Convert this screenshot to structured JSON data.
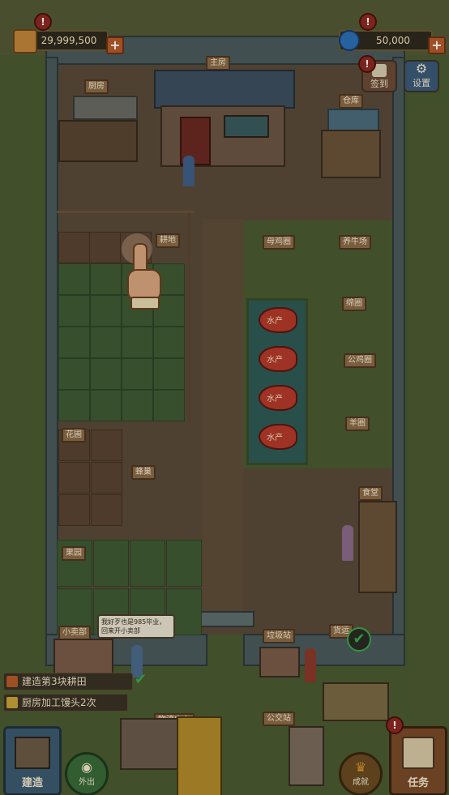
{
  "resources": {
    "coins": "29,999,500",
    "gems": "50,000"
  },
  "top_buttons": {
    "checkin": "签到",
    "settings": "设置"
  },
  "buildings": {
    "main_house": "主房",
    "kitchen": "厨房",
    "warehouse": "仓库",
    "farmland": "耕地",
    "hen_house": "母鸡圈",
    "cow_shed": "养牛场",
    "sheep_pen": "绵圈",
    "rooster_pen": "公鸡圈",
    "goat_pen": "羊圈",
    "flower_bed": "花圃",
    "bee_box": "蜂巢",
    "orchard": "果园",
    "canteen": "食堂",
    "shop": "小卖部",
    "recycle_station": "垃圾站",
    "freight": "货运",
    "logistics_center": "物流中心",
    "bus_station": "公交站"
  },
  "pond_label": "水产",
  "npc_speech": "我好歹也是985毕业，回来开小卖部",
  "tasks": [
    "建造第3块耕田",
    "厨房加工馒头2次"
  ],
  "bottom_nav": {
    "build": "建造",
    "go_out": "外出",
    "achievement": "成就",
    "quests": "任务"
  },
  "colors": {
    "grass": "#4b5a30",
    "dirt": "#5b4a38",
    "accent_red": "#8d2a22",
    "check_green": "#3aa84a"
  }
}
